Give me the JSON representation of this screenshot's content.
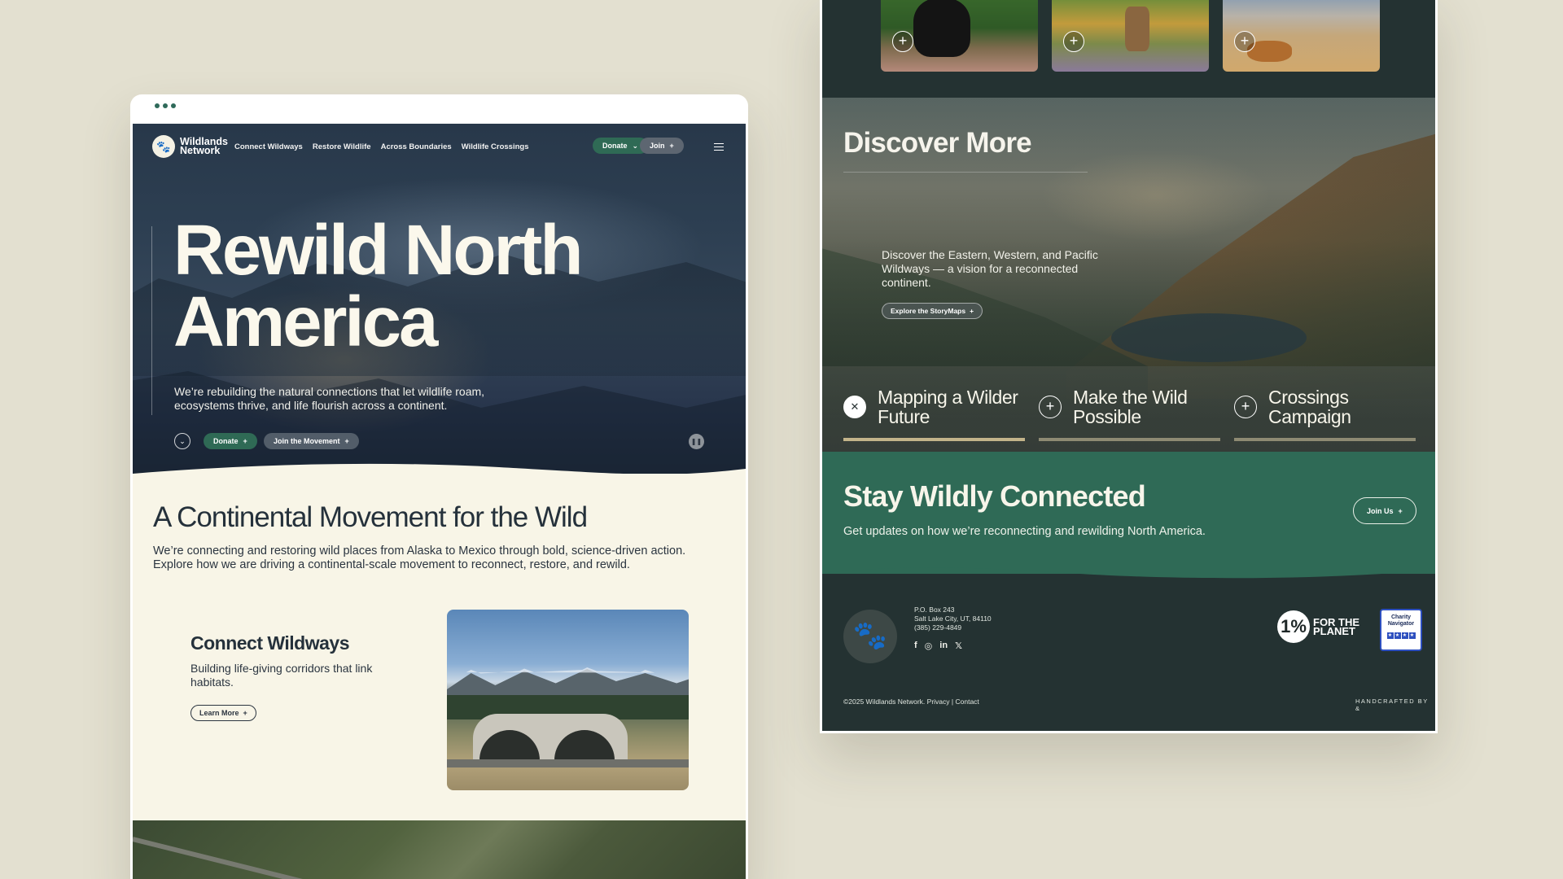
{
  "left": {
    "brand": {
      "name_line1": "Wildlands",
      "name_line2": "Network"
    },
    "nav": {
      "links": [
        "Connect Wildways",
        "Restore Wildlife",
        "Across Boundaries",
        "Wildlife Crossings"
      ],
      "donate_label": "Donate",
      "join_label": "Join"
    },
    "hero": {
      "title": "Rewild North America",
      "subtitle": "We’re rebuilding the natural connections that let wildlife roam, ecosystems thrive, and life flourish across a continent.",
      "donate_label": "Donate",
      "join_label": "Join the Movement"
    },
    "intro": {
      "title": "A Continental Movement for the Wild",
      "body": "We’re connecting and restoring wild places from Alaska to Mexico through bold, science-driven action. Explore how we are driving a continental-scale movement to reconnect, restore, and rewild."
    },
    "card": {
      "title": "Connect Wildways",
      "body": "Building life-giving corridors that link habitats.",
      "button_label": "Learn More"
    }
  },
  "right": {
    "discover": {
      "title": "Discover More",
      "body": "Discover the Eastern, Western, and Pacific Wildways — a vision for a reconnected continent.",
      "button_label": "Explore the StoryMaps",
      "tabs": [
        {
          "label": "Mapping a Wilder Future",
          "active": true
        },
        {
          "label": "Make the Wild Possible",
          "active": false
        },
        {
          "label": "Crossings Campaign",
          "active": false
        }
      ]
    },
    "newsletter": {
      "title": "Stay Wildly Connected",
      "body": "Get updates on how we’re reconnecting and rewilding North America.",
      "button_label": "Join Us"
    },
    "footer": {
      "address_line1": "P.O. Box 243",
      "address_line2": "Salt Lake City, UT, 84110",
      "phone": "(385) 229-4849",
      "onepct_line1": "FOR THE",
      "onepct_line2": "PLANET",
      "charity_name": "Charity Navigator",
      "copyright": "©2025 Wildlands Network.",
      "privacy": "Privacy",
      "contact": "Contact",
      "handcrafted": "HANDCRAFTED BY"
    }
  },
  "icons": {
    "social": [
      "facebook-icon",
      "instagram-icon",
      "linkedin-icon",
      "x-icon"
    ]
  },
  "colors": {
    "background": "#e3e0d0",
    "accent_green": "#2f6a55",
    "footer_dark": "#243232",
    "cream": "#f8f5e7"
  }
}
